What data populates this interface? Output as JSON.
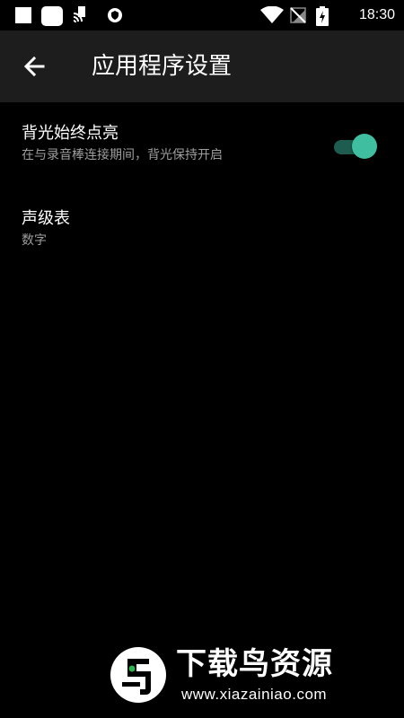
{
  "status_bar": {
    "time": "18:30",
    "icons": [
      "notification-square-icon",
      "notification-rounded-icon",
      "nfc-icon",
      "vpn-shield-icon",
      "wifi-icon",
      "no-sim-icon",
      "battery-charging-icon"
    ]
  },
  "app_bar": {
    "title": "应用程序设置",
    "back_icon": "arrow-left-icon"
  },
  "settings": [
    {
      "title": "背光始终点亮",
      "subtitle": "在与录音棒连接期间，背光保持开启",
      "toggle_on": true
    },
    {
      "title": "声级表",
      "subtitle": "数字"
    }
  ],
  "watermark": {
    "title": "下载鸟资源",
    "url": "www.xiazainiao.com"
  },
  "colors": {
    "background": "#000000",
    "app_bar": "#1d1d1d",
    "accent": "#3fbfa0",
    "accent_track": "#1d5c4f",
    "secondary_text": "#9e9e9e"
  }
}
